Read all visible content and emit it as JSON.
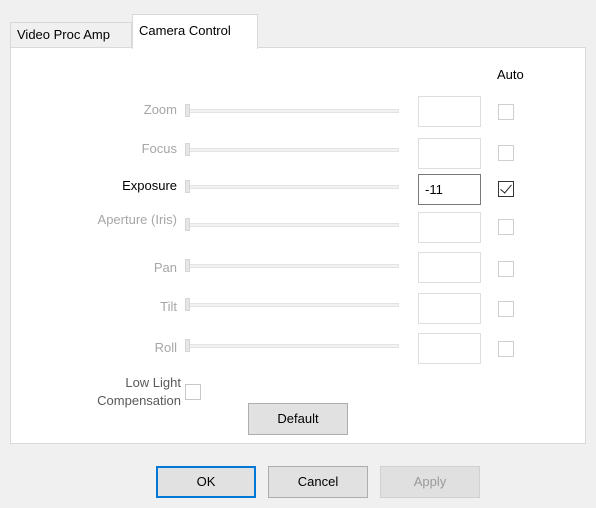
{
  "tabs": [
    {
      "label": "Video Proc Amp",
      "active": false
    },
    {
      "label": "Camera Control",
      "active": true
    }
  ],
  "auto_header": "Auto",
  "controls": [
    {
      "label": "Zoom",
      "value": "",
      "enabled": false,
      "auto": false
    },
    {
      "label": "Focus",
      "value": "",
      "enabled": false,
      "auto": false
    },
    {
      "label": "Exposure",
      "value": "-11",
      "enabled": true,
      "auto": true
    },
    {
      "label": "Aperture (Iris)",
      "value": "",
      "enabled": false,
      "auto": false
    },
    {
      "label": "Pan",
      "value": "",
      "enabled": false,
      "auto": false
    },
    {
      "label": "Tilt",
      "value": "",
      "enabled": false,
      "auto": false
    },
    {
      "label": "Roll",
      "value": "",
      "enabled": false,
      "auto": false
    }
  ],
  "low_light": {
    "label": "Low Light Compensation",
    "checked": false
  },
  "buttons": {
    "default": "Default",
    "ok": "OK",
    "cancel": "Cancel",
    "apply": "Apply"
  }
}
